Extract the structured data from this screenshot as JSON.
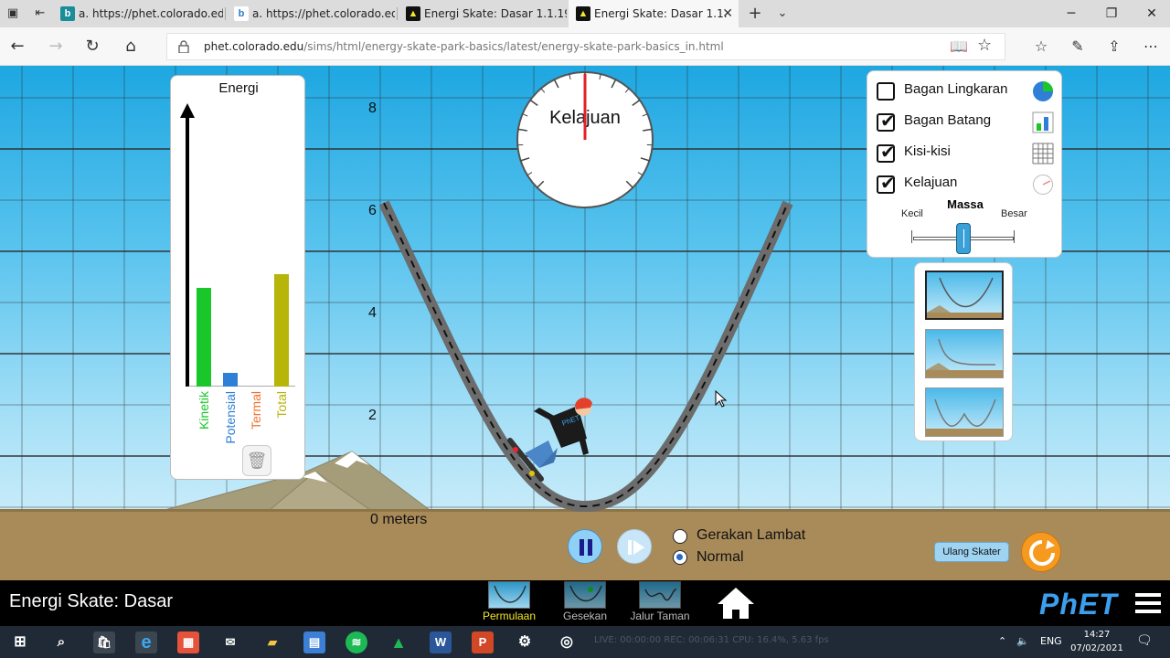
{
  "browser": {
    "tabs": [
      {
        "label": "a. https://phet.colorado.edu",
        "icon": "bing-icon"
      },
      {
        "label": "a. https://phet.colorado.edu",
        "icon": "bing-icon"
      },
      {
        "label": "Energi Skate: Dasar 1.1.19",
        "icon": "phet-icon"
      },
      {
        "label": "Energi Skate: Dasar 1.1.",
        "icon": "phet-icon"
      }
    ],
    "url_host": "phet.colorado.edu",
    "url_path": "/sims/html/energy-skate-park-basics/latest/energy-skate-park-basics_in.html"
  },
  "energy_chart": {
    "title": "Energi",
    "bars": [
      {
        "label": "Kinetik",
        "value": 0.36,
        "color": "#19c72a"
      },
      {
        "label": "Potensial",
        "value": 0.05,
        "color": "#2f7fd6"
      },
      {
        "label": "Termal",
        "value": 0.0,
        "color": "#ef7230"
      },
      {
        "label": "Total",
        "value": 0.41,
        "color": "#b7b40a"
      }
    ]
  },
  "height_axis": {
    "ticks": [
      "8",
      "6",
      "4",
      "2"
    ],
    "ground_label": "0 meters"
  },
  "speedometer": {
    "label": "Kelajuan",
    "needle_fraction": 0.5
  },
  "options": {
    "checkboxes": [
      {
        "label": "Bagan Lingkaran",
        "checked": false,
        "icon": "pie-chart-icon"
      },
      {
        "label": "Bagan Batang",
        "checked": true,
        "icon": "bar-chart-icon"
      },
      {
        "label": "Kisi-kisi",
        "checked": true,
        "icon": "grid-icon"
      },
      {
        "label": "Kelajuan",
        "checked": true,
        "icon": "speedometer-icon"
      }
    ],
    "mass": {
      "title": "Massa",
      "min_label": "Kecil",
      "max_label": "Besar",
      "value_fraction": 0.5
    }
  },
  "playback": {
    "speed_options": [
      {
        "label": "Gerakan Lambat",
        "selected": false
      },
      {
        "label": "Normal",
        "selected": true
      }
    ],
    "reset_skater_label": "Ulang Skater"
  },
  "phet_nav": {
    "sim_title": "Energi Skate: Dasar",
    "screens": [
      {
        "label": "Permulaan",
        "active": true
      },
      {
        "label": "Gesekan",
        "active": false
      },
      {
        "label": "Jalur Taman",
        "active": false
      }
    ],
    "logo": "PhET"
  },
  "taskbar": {
    "status_text": "LIVE: 00:00:00   REC: 00:06:31   CPU: 16.4%, 5.63 fps",
    "lang": "ENG",
    "time": "14:27",
    "date": "07/02/2021"
  }
}
